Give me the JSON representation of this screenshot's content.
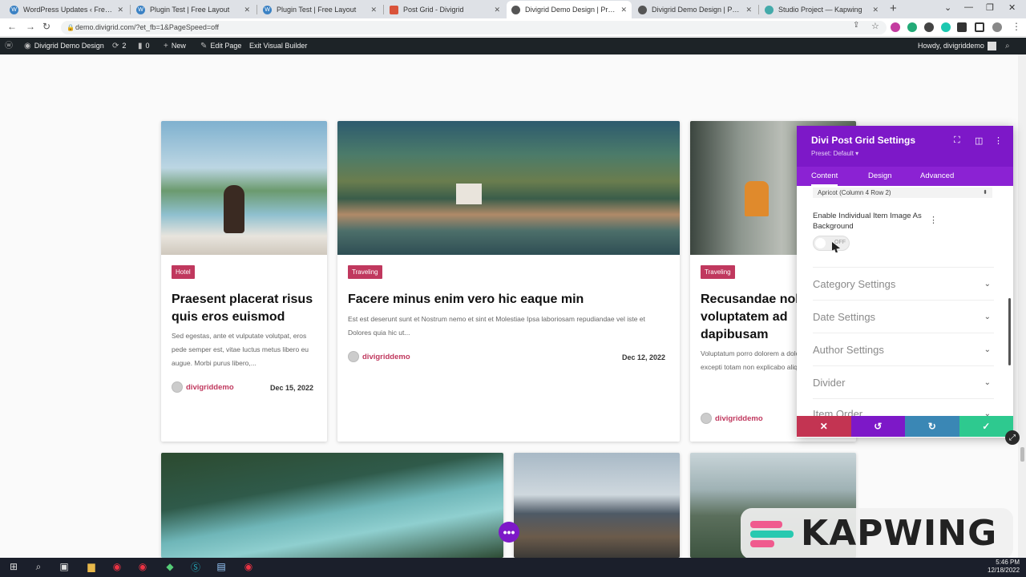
{
  "browser": {
    "tabs": [
      {
        "title": "WordPress Updates ‹ Free Layo"
      },
      {
        "title": "Plugin Test | Free Layout"
      },
      {
        "title": "Plugin Test | Free Layout"
      },
      {
        "title": "Post Grid - Divigrid"
      },
      {
        "title": "Divigrid Demo Design | Premad"
      },
      {
        "title": "Divigrid Demo Design | Premad"
      },
      {
        "title": "Studio Project — Kapwing"
      }
    ],
    "url": "demo.divigrid.com/?et_fb=1&PageSpeed=off"
  },
  "wpbar": {
    "site": "Divigrid Demo Design",
    "updates": "2",
    "comments": "0",
    "new": "New",
    "edit": "Edit Page",
    "exit": "Exit Visual Builder",
    "howdy": "Howdy, divigriddemo"
  },
  "cards": [
    {
      "category": "Hotel",
      "title": "Praesent placerat risus quis eros euismod",
      "excerpt": "Sed egestas, ante et vulputate volutpat, eros pede semper est, vitae luctus metus libero eu augue. Morbi purus libero,...",
      "author": "divigriddemo",
      "date": "Dec 15, 2022"
    },
    {
      "category": "Traveling",
      "title": "Facere minus enim vero hic eaque min",
      "excerpt": "Est est deserunt sunt et Nostrum nemo et sint et Molestiae Ipsa laboriosam repudiandae vel iste et Dolores quia hic ut...",
      "author": "divigriddemo",
      "date": "Dec 12, 2022"
    },
    {
      "category": "Traveling",
      "title": "Recusandae nob voluptatem ad dapibusam",
      "excerpt": "Voluptatum porro dolorem a dolorem dignissimos excepti totam non explicabo aliquam Voluptas...",
      "author": "divigriddemo",
      "date": ""
    }
  ],
  "panel": {
    "title": "Divi Post Grid Settings",
    "preset": "Preset: Default ▾",
    "tabs": [
      "Content",
      "Design",
      "Advanced"
    ],
    "select_value": "Apricot (Column 4 Row 2)",
    "toggle_label": "Enable Individual Item Image As Background",
    "toggle_state": "OFF",
    "sections": [
      "Category Settings",
      "Date Settings",
      "Author Settings",
      "Divider",
      "Item Order"
    ]
  },
  "overlay": {
    "brand": "KAPWING"
  },
  "taskbar": {
    "time": "5:46 PM",
    "date": "12/18/2022"
  },
  "colors": {
    "accent_purple": "#7d18c8",
    "badge": "#c0385e",
    "cancel": "#c33452",
    "undo": "#7d18c8",
    "redo": "#3a87b5",
    "save": "#2ec98f"
  }
}
